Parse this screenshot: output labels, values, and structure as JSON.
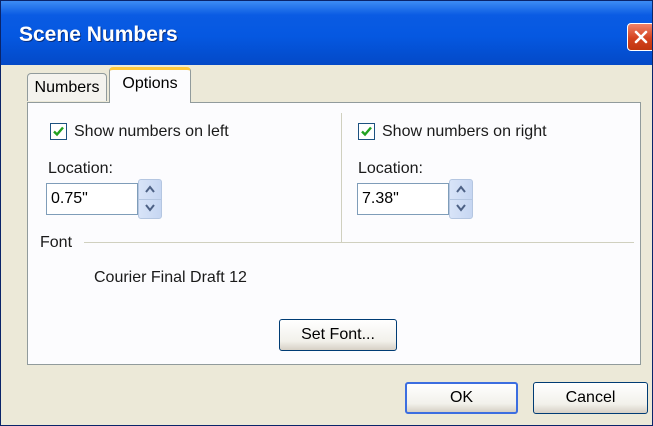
{
  "window": {
    "title": "Scene Numbers"
  },
  "tabs": [
    {
      "label": "Numbers",
      "active": false
    },
    {
      "label": "Options",
      "active": true
    }
  ],
  "left": {
    "checkbox_label": "Show numbers on left",
    "checked": true,
    "location_label": "Location:",
    "location_value": "0.75\""
  },
  "right": {
    "checkbox_label": "Show numbers on right",
    "checked": true,
    "location_label": "Location:",
    "location_value": "7.38\""
  },
  "font": {
    "section_label": "Font",
    "current_font": "Courier Final Draft 12",
    "set_font_label": "Set Font..."
  },
  "buttons": {
    "ok": "OK",
    "cancel": "Cancel"
  },
  "icons": {
    "close": "close-icon",
    "check": "checkmark-icon",
    "up": "arrow-up-icon",
    "down": "arrow-down-icon"
  }
}
